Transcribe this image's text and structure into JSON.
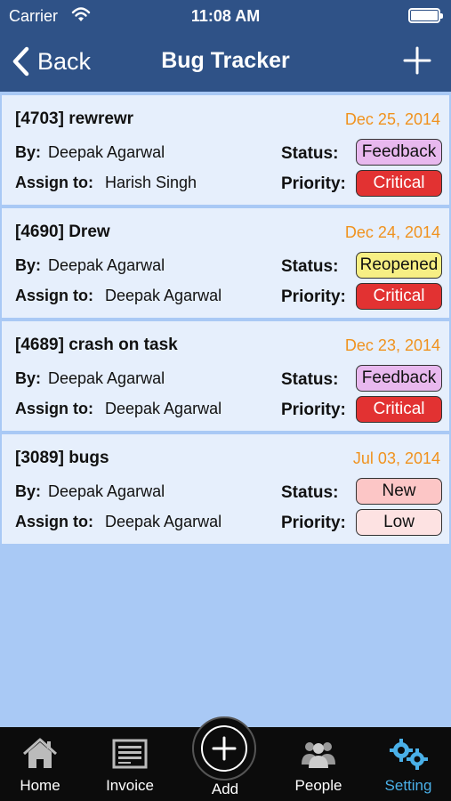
{
  "status_bar": {
    "carrier": "Carrier",
    "time": "11:08 AM"
  },
  "nav": {
    "back_label": "Back",
    "title": "Bug Tracker"
  },
  "labels": {
    "by": "By:",
    "assign": "Assign to:",
    "status": "Status:",
    "priority": "Priority:"
  },
  "bugs": [
    {
      "title": "[4703] rewrewr",
      "date": "Dec 25, 2014",
      "by": "Deepak Agarwal",
      "assignee": "Harish Singh",
      "status": "Feedback",
      "status_color": "#e8b8ee",
      "priority": "Critical",
      "priority_color": "#e23232"
    },
    {
      "title": "[4690] Drew",
      "date": "Dec 24, 2014",
      "by": "Deepak Agarwal",
      "assignee": "Deepak Agarwal",
      "status": "Reopened",
      "status_color": "#f7ef84",
      "priority": "Critical",
      "priority_color": "#e23232"
    },
    {
      "title": "[4689] crash on task",
      "date": "Dec 23, 2014",
      "by": "Deepak Agarwal",
      "assignee": "Deepak Agarwal",
      "status": "Feedback",
      "status_color": "#e8b8ee",
      "priority": "Critical",
      "priority_color": "#e23232"
    },
    {
      "title": "[3089] bugs",
      "date": "Jul 03, 2014",
      "by": "Deepak Agarwal",
      "assignee": "Deepak Agarwal",
      "status": "New",
      "status_color": "#fcc6c6",
      "priority": "Low",
      "priority_color": "#fde2e2"
    }
  ],
  "tabs": [
    {
      "label": "Home",
      "icon": "home-icon"
    },
    {
      "label": "Invoice",
      "icon": "invoice-icon"
    },
    {
      "label": "Add",
      "icon": "add-icon"
    },
    {
      "label": "People",
      "icon": "people-icon"
    },
    {
      "label": "Setting",
      "icon": "settings-icon",
      "active": true
    }
  ]
}
